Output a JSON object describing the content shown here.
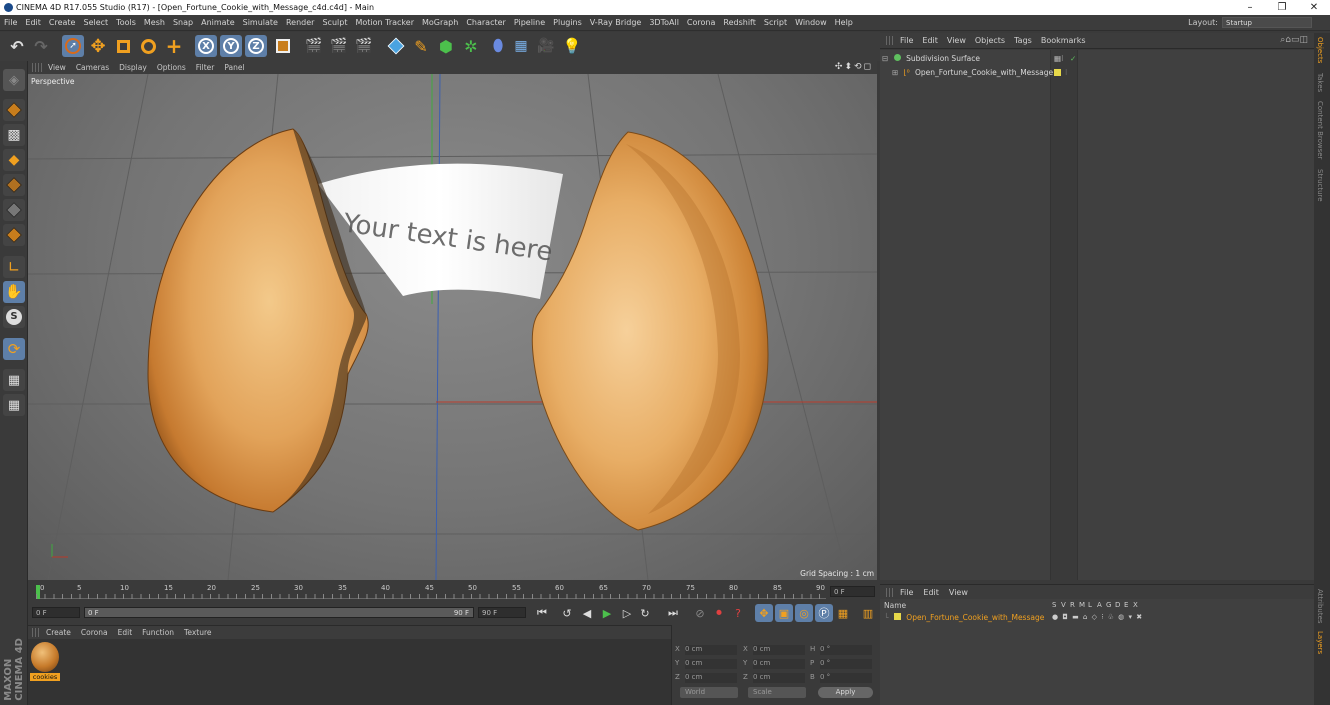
{
  "window": {
    "title": "CINEMA 4D R17.055 Studio (R17) - [Open_Fortune_Cookie_with_Message_c4d.c4d] - Main",
    "controls": {
      "minimize": "–",
      "restore": "❐",
      "close": "✕"
    }
  },
  "menubar": {
    "items": [
      "File",
      "Edit",
      "Create",
      "Select",
      "Tools",
      "Mesh",
      "Snap",
      "Animate",
      "Simulate",
      "Render",
      "Sculpt",
      "Motion Tracker",
      "MoGraph",
      "Character",
      "Pipeline",
      "Plugins",
      "V-Ray Bridge",
      "3DToAll",
      "Corona",
      "Redshift",
      "Script",
      "Window",
      "Help"
    ],
    "layout_label": "Layout:",
    "layout_value": "Startup"
  },
  "toolbar": {
    "axis_x": "X",
    "axis_y": "Y",
    "axis_z": "Z"
  },
  "viewport": {
    "menu": [
      "View",
      "Cameras",
      "Display",
      "Options",
      "Filter",
      "Panel"
    ],
    "camera_label": "Perspective",
    "grid_spacing": "Grid Spacing : 1 cm",
    "nav_icons": "✣⬍⟲◻",
    "message_text": "Your text is here"
  },
  "timeline": {
    "ticks": [
      "0",
      "5",
      "10",
      "15",
      "20",
      "25",
      "30",
      "35",
      "40",
      "45",
      "50",
      "55",
      "60",
      "65",
      "70",
      "75",
      "80",
      "85",
      "90"
    ],
    "frame_readout": "0 F",
    "start_field": "0 F",
    "range_start": "0 F",
    "range_end": "90 F",
    "end_field": "90 F"
  },
  "material_manager": {
    "menu": [
      "Create",
      "Corona",
      "Edit",
      "Function",
      "Texture"
    ],
    "material_name": "cookies"
  },
  "coordinates": {
    "rows": [
      {
        "a_label": "X",
        "a_val": "0 cm",
        "b_label": "X",
        "b_val": "0 cm",
        "c_label": "H",
        "c_val": "0 °"
      },
      {
        "a_label": "Y",
        "a_val": "0 cm",
        "b_label": "Y",
        "b_val": "0 cm",
        "c_label": "P",
        "c_val": "0 °"
      },
      {
        "a_label": "Z",
        "a_val": "0 cm",
        "b_label": "Z",
        "b_val": "0 cm",
        "c_label": "B",
        "c_val": "0 °"
      }
    ],
    "mode_world": "World",
    "mode_scale": "Scale",
    "apply_label": "Apply"
  },
  "object_manager": {
    "menu": [
      "File",
      "Edit",
      "View",
      "Objects",
      "Tags",
      "Bookmarks"
    ],
    "objects": [
      {
        "name": "Subdivision Surface"
      },
      {
        "name": "Open_Fortune_Cookie_with_Message"
      }
    ]
  },
  "layer_manager": {
    "menu": [
      "File",
      "Edit",
      "View"
    ],
    "name_header": "Name",
    "col_headers": [
      "S",
      "V",
      "R",
      "M",
      "L",
      "A",
      "G",
      "D",
      "E",
      "X"
    ],
    "layer_name": "Open_Fortune_Cookie_with_Message"
  },
  "side_tabs": [
    "Objects",
    "Takes",
    "Content Browser",
    "Structure"
  ],
  "side_tabs_bottom": [
    "Attributes",
    "Layers"
  ],
  "colors": {
    "accent_orange": "#f0a020",
    "layer_yellow": "#e6d84a",
    "sds_green": "#5fc05f",
    "toolbar_blue": "#5e7fa8"
  }
}
